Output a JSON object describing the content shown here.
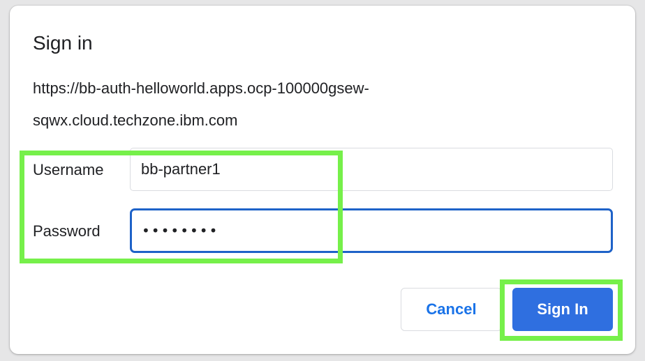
{
  "dialog": {
    "title": "Sign in",
    "url_line1": "https://bb-auth-helloworld.apps.ocp-100000gsew-",
    "url_line2": "sqwx.cloud.techzone.ibm.com"
  },
  "form": {
    "username_label": "Username",
    "username_value": "bb-partner1",
    "password_label": "Password",
    "password_masked": "••••••••"
  },
  "buttons": {
    "cancel_label": "Cancel",
    "signin_label": "Sign In"
  },
  "colors": {
    "primary": "#2f6fe0",
    "focus_border": "#1e62c8",
    "link_blue": "#1a73e8",
    "highlight": "#76f04a"
  }
}
